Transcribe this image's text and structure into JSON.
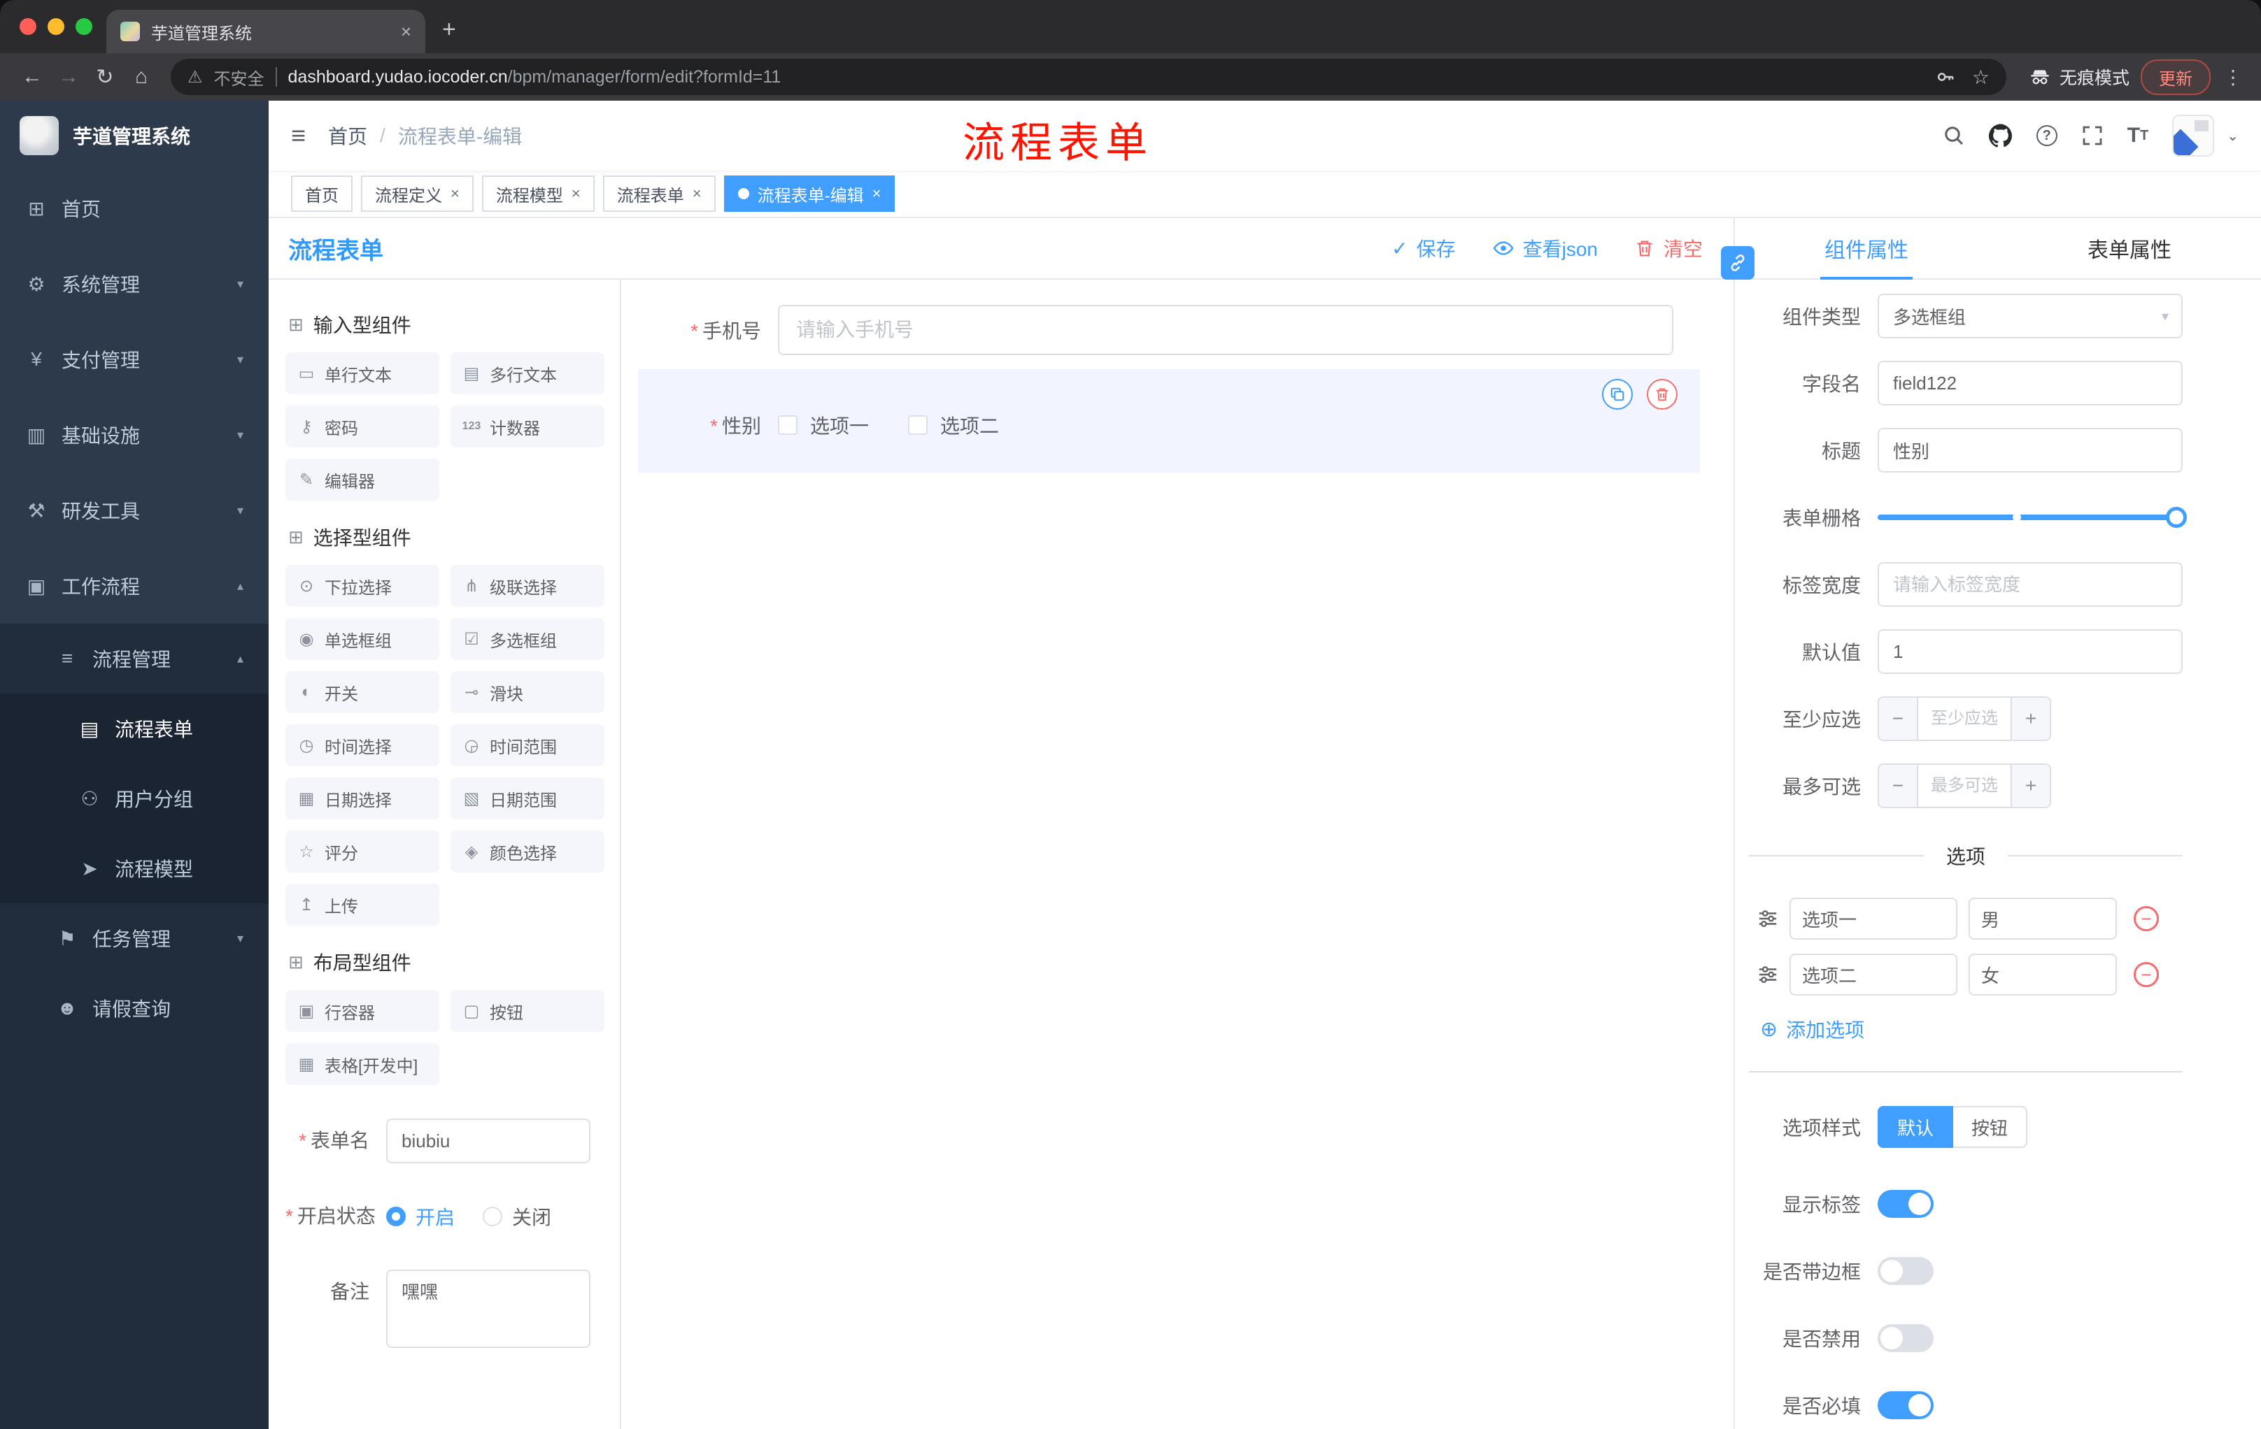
{
  "colors": {
    "accent": "#409eff",
    "danger": "#f56c6c",
    "annotation": "#fe1400"
  },
  "browser": {
    "tab_title": "芋道管理系统",
    "security_label": "不安全",
    "url_domain": "dashboard.yudao.iocoder.cn",
    "url_path": "/bpm/manager/form/edit?formId=11",
    "incognito_label": "无痕模式",
    "update_label": "更新"
  },
  "annotation": {
    "text": "流程表单"
  },
  "sidebar": {
    "logo_title": "芋道管理系统",
    "items": [
      {
        "label": "首页"
      },
      {
        "label": "系统管理"
      },
      {
        "label": "支付管理"
      },
      {
        "label": "基础设施"
      },
      {
        "label": "研发工具"
      },
      {
        "label": "工作流程"
      },
      {
        "label": "流程管理"
      },
      {
        "label": "流程表单"
      },
      {
        "label": "用户分组"
      },
      {
        "label": "流程模型"
      },
      {
        "label": "任务管理"
      },
      {
        "label": "请假查询"
      }
    ]
  },
  "header": {
    "breadcrumb": [
      "首页",
      "流程表单-编辑"
    ]
  },
  "tags": [
    {
      "label": "首页"
    },
    {
      "label": "流程定义"
    },
    {
      "label": "流程模型"
    },
    {
      "label": "流程表单"
    },
    {
      "label": "流程表单-编辑"
    }
  ],
  "designer": {
    "title": "流程表单",
    "toolbar": {
      "save": "保存",
      "view_json": "查看json",
      "clear": "清空"
    }
  },
  "palette": {
    "sections": [
      {
        "title": "输入型组件",
        "items": [
          {
            "label": "单行文本"
          },
          {
            "label": "多行文本"
          },
          {
            "label": "密码"
          },
          {
            "label": "计数器"
          },
          {
            "label": "编辑器"
          }
        ]
      },
      {
        "title": "选择型组件",
        "items": [
          {
            "label": "下拉选择"
          },
          {
            "label": "级联选择"
          },
          {
            "label": "单选框组"
          },
          {
            "label": "多选框组"
          },
          {
            "label": "开关"
          },
          {
            "label": "滑块"
          },
          {
            "label": "时间选择"
          },
          {
            "label": "时间范围"
          },
          {
            "label": "日期选择"
          },
          {
            "label": "日期范围"
          },
          {
            "label": "评分"
          },
          {
            "label": "颜色选择"
          },
          {
            "label": "上传"
          }
        ]
      },
      {
        "title": "布局型组件",
        "items": [
          {
            "label": "行容器"
          },
          {
            "label": "按钮"
          },
          {
            "label": "表格[开发中]"
          }
        ]
      }
    ],
    "form": {
      "name_label": "表单名",
      "name_value": "biubiu",
      "status_label": "开启状态",
      "status_on": "开启",
      "status_off": "关闭",
      "remark_label": "备注",
      "remark_value": "嘿嘿"
    }
  },
  "canvas": {
    "phone": {
      "label": "手机号",
      "placeholder": "请输入手机号"
    },
    "gender": {
      "label": "性别",
      "options": [
        {
          "label": "选项一"
        },
        {
          "label": "选项二"
        }
      ]
    }
  },
  "inspector": {
    "tabs": {
      "component": "组件属性",
      "form": "表单属性"
    },
    "rows": {
      "component_type": {
        "label": "组件类型",
        "value": "多选框组"
      },
      "field_name": {
        "label": "字段名",
        "value": "field122"
      },
      "title": {
        "label": "标题",
        "value": "性别"
      },
      "form_grid": {
        "label": "表单栅格"
      },
      "label_width": {
        "label": "标签宽度",
        "placeholder": "请输入标签宽度"
      },
      "default_value": {
        "label": "默认值",
        "value": "1"
      },
      "min_select": {
        "label": "至少应选",
        "placeholder": "至少应选"
      },
      "max_select": {
        "label": "最多可选",
        "placeholder": "最多可选"
      }
    },
    "options_title": "选项",
    "options": [
      {
        "name": "选项一",
        "value": "男"
      },
      {
        "name": "选项二",
        "value": "女"
      }
    ],
    "add_option": "添加选项",
    "option_style": {
      "label": "选项样式",
      "default": "默认",
      "button": "按钮"
    },
    "toggles": [
      {
        "label": "显示标签",
        "on": true
      },
      {
        "label": "是否带边框",
        "on": false
      },
      {
        "label": "是否禁用",
        "on": false
      },
      {
        "label": "是否必填",
        "on": true
      }
    ]
  }
}
